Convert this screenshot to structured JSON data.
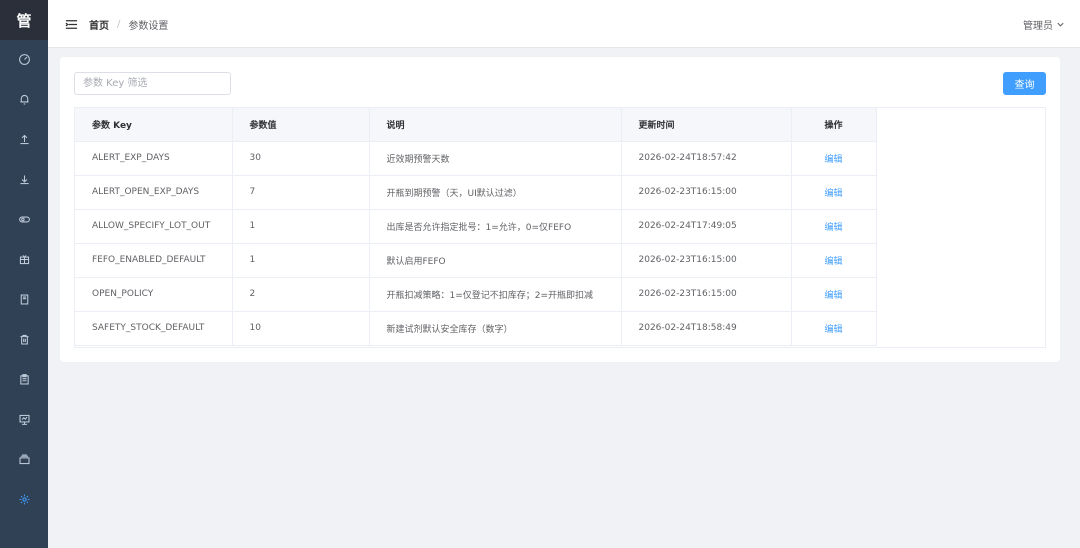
{
  "sidebar": {
    "logo": "管",
    "items": [
      {
        "icon": "dashboard-icon"
      },
      {
        "icon": "bell-icon"
      },
      {
        "icon": "upload-icon"
      },
      {
        "icon": "download-icon"
      },
      {
        "icon": "toggle-icon"
      },
      {
        "icon": "package-icon"
      },
      {
        "icon": "book-icon"
      },
      {
        "icon": "trash-icon"
      },
      {
        "icon": "clipboard-icon"
      },
      {
        "icon": "presentation-icon"
      },
      {
        "icon": "box-icon"
      },
      {
        "icon": "settings-icon",
        "active": true
      }
    ]
  },
  "header": {
    "breadcrumb_home": "首页",
    "breadcrumb_separator": "/",
    "breadcrumb_current": "参数设置",
    "user": "管理员"
  },
  "filter": {
    "placeholder": "参数 Key 筛选",
    "value": ""
  },
  "query_button": "查询",
  "table": {
    "headers": [
      "参数 Key",
      "参数值",
      "说明",
      "更新时间",
      "操作"
    ],
    "rows": [
      {
        "key": "ALERT_EXP_DAYS",
        "value": "30",
        "desc": "近效期预警天数",
        "updated": "2026-02-24T18:57:42",
        "action": "编辑"
      },
      {
        "key": "ALERT_OPEN_EXP_DAYS",
        "value": "7",
        "desc": "开瓶到期预警（天，UI默认过滤）",
        "updated": "2026-02-23T16:15:00",
        "action": "编辑"
      },
      {
        "key": "ALLOW_SPECIFY_LOT_OUT",
        "value": "1",
        "desc": "出库是否允许指定批号：1=允许，0=仅FEFO",
        "updated": "2026-02-24T17:49:05",
        "action": "编辑"
      },
      {
        "key": "FEFO_ENABLED_DEFAULT",
        "value": "1",
        "desc": "默认启用FEFO",
        "updated": "2026-02-23T16:15:00",
        "action": "编辑"
      },
      {
        "key": "OPEN_POLICY",
        "value": "2",
        "desc": "开瓶扣减策略：1=仅登记不扣库存；2=开瓶即扣减",
        "updated": "2026-02-23T16:15:00",
        "action": "编辑"
      },
      {
        "key": "SAFETY_STOCK_DEFAULT",
        "value": "10",
        "desc": "新建试剂默认安全库存（数字）",
        "updated": "2026-02-24T18:58:49",
        "action": "编辑"
      }
    ]
  },
  "colors": {
    "sidebar_bg": "#304156",
    "sidebar_icon": "#bfcbd9",
    "sidebar_active": "#409eff",
    "primary": "#409eff"
  }
}
